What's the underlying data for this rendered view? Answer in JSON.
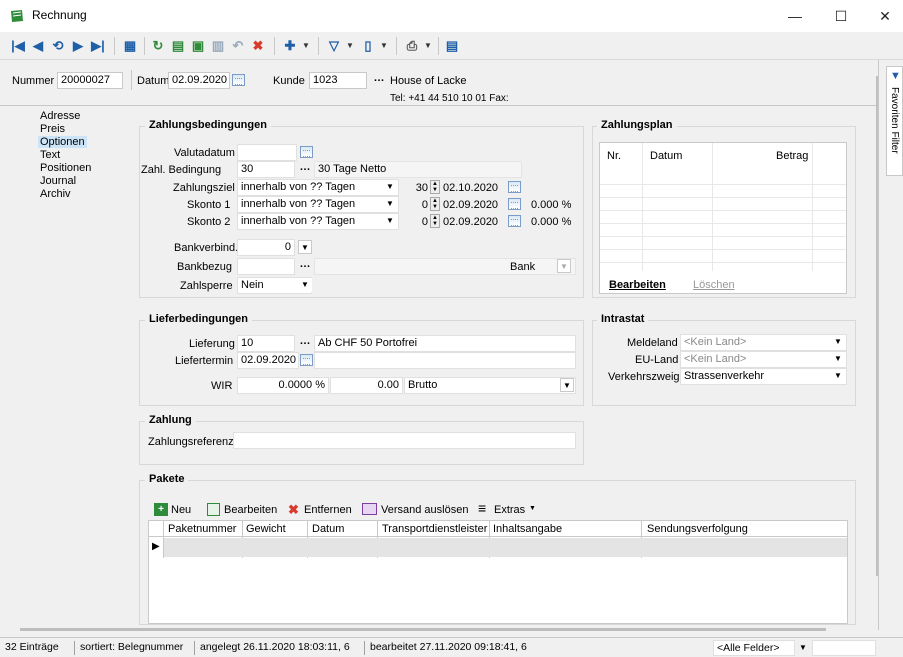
{
  "window": {
    "title": "Rechnung",
    "minimize": "—",
    "maximize": "☐",
    "close": "✕"
  },
  "header": {
    "nummer_label": "Nummer",
    "nummer_value": "20000027",
    "datum_label": "Datum",
    "datum_value": "02.09.2020",
    "kunde_label": "Kunde",
    "kunde_value": "1023",
    "kunde_name": "House of Lacke",
    "contact": "Tel: +41 44 510 10 01   Fax:"
  },
  "nav": {
    "items": [
      "Adresse",
      "Preis",
      "Optionen",
      "Text",
      "Positionen",
      "Journal",
      "Archiv"
    ],
    "selected": "Optionen"
  },
  "zahlungsbedingungen": {
    "title": "Zahlungsbedingungen",
    "valutadatum_label": "Valutadatum",
    "zahlbed_label": "Zahl. Bedingung",
    "zahlbed_value": "30",
    "zahlbed_text": "30 Tage Netto",
    "zahlungsziel_label": "Zahlungsziel",
    "zahlungsziel_mode": "innerhalb von ?? Tagen",
    "zahlungsziel_days": "30",
    "zahlungsziel_date": "02.10.2020",
    "skonto1_label": "Skonto 1",
    "skonto1_mode": "innerhalb von ?? Tagen",
    "skonto1_days": "0",
    "skonto1_date": "02.09.2020",
    "skonto1_pct": "0.000 %",
    "skonto2_label": "Skonto 2",
    "skonto2_mode": "innerhalb von ?? Tagen",
    "skonto2_days": "0",
    "skonto2_date": "02.09.2020",
    "skonto2_pct": "0.000 %",
    "bankverbind_label": "Bankverbind.",
    "bankverbind_value": "0",
    "bankbezug_label": "Bankbezug",
    "bankbezug_type": "Bank",
    "zahlsperre_label": "Zahlsperre",
    "zahlsperre_value": "Nein"
  },
  "zahlungsplan": {
    "title": "Zahlungsplan",
    "columns": [
      "Nr.",
      "Datum",
      "Betrag"
    ],
    "bearbeiten": "Bearbeiten",
    "loeschen": "Löschen"
  },
  "lieferbedingungen": {
    "title": "Lieferbedingungen",
    "lieferung_label": "Lieferung",
    "lieferung_value": "10",
    "lieferung_text": "Ab CHF 50 Portofrei",
    "liefertermin_label": "Liefertermin",
    "liefertermin_value": "02.09.2020",
    "wir_label": "WIR",
    "wir_pct": "0.0000 %",
    "wir_amount": "0.00",
    "wir_mode": "Brutto"
  },
  "intrastat": {
    "title": "Intrastat",
    "meldeland_label": "Meldeland",
    "meldeland_value": "<Kein Land>",
    "euland_label": "EU-Land",
    "euland_value": "<Kein Land>",
    "verkehrszweig_label": "Verkehrszweig",
    "verkehrszweig_value": "Strassenverkehr"
  },
  "zahlung": {
    "title": "Zahlung",
    "referenz_label": "Zahlungsreferenz"
  },
  "pakete": {
    "title": "Pakete",
    "toolbar": {
      "neu": "Neu",
      "bearbeiten": "Bearbeiten",
      "entfernen": "Entfernen",
      "versand": "Versand auslösen",
      "extras": "Extras"
    },
    "columns": [
      "Paketnummer",
      "Gewicht",
      "Datum",
      "Transportdienstleister",
      "Inhaltsangabe",
      "Sendungsverfolgung"
    ]
  },
  "sidebar": {
    "favoriten": "Favoriten Filter"
  },
  "statusbar": {
    "count": "32 Einträge",
    "sort": "sortiert: Belegnummer",
    "created": "angelegt 26.11.2020 18:03:11, 6",
    "edited": "bearbeitet 27.11.2020 09:18:41, 6",
    "filter": "<Alle Felder>"
  },
  "colors": {
    "accent_blue": "#1f5fa8",
    "toolbar_green": "#2e8b3a",
    "delete_red": "#d83b2b",
    "selection": "#cce4f7"
  }
}
